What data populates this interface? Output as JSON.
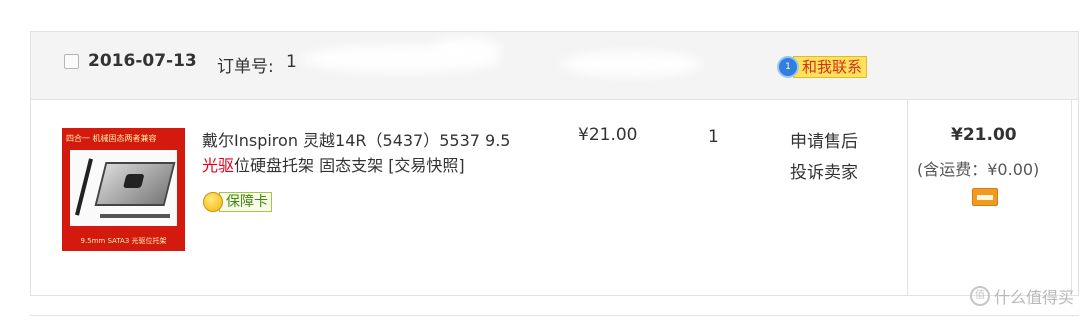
{
  "order": {
    "date": "2016-07-13",
    "order_no_label": "订单号:",
    "order_no_value": "1"
  },
  "contact": {
    "icon_text": "1",
    "label": "和我联系"
  },
  "product": {
    "thumb_top_text": "四合一 机械固态两者兼容",
    "thumb_bottom_text": "9.5mm SATA3 光驱位托架",
    "title_part1": "戴尔Inspiron 灵越14R（5437）5537 9.5 ",
    "title_highlight": "光驱",
    "title_part2": "位硬盘托架 固态支架 [交易快照]",
    "badge_label": "保障卡"
  },
  "price": "¥21.00",
  "quantity": "1",
  "actions": {
    "after_sale": "申请售后",
    "complain": "投诉卖家"
  },
  "total": {
    "amount": "¥21.00",
    "shipping": "(含运费：¥0.00)"
  },
  "watermark": {
    "icon_text": "值",
    "text": "什么值得买"
  },
  "colors": {
    "header_bg": "#f4f4f4",
    "highlight_red": "#e4001a",
    "contact_yellow": "#ffe15a",
    "badge_green": "#3d8a12"
  },
  "icons": {
    "contact": "chat-bubble-icon",
    "badge": "medal-icon",
    "payment": "card-icon"
  }
}
